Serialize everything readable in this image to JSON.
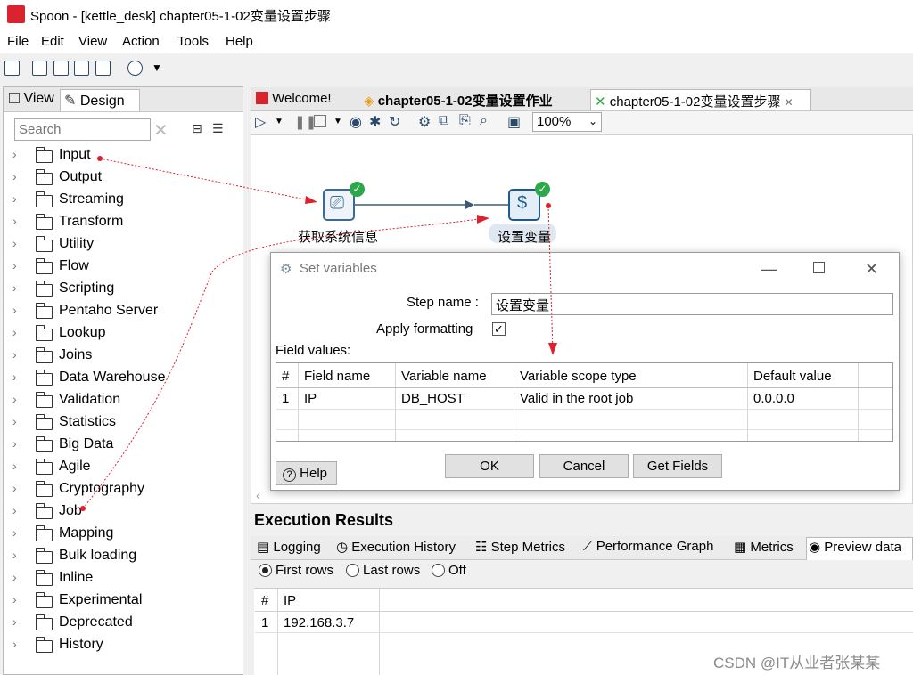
{
  "window": {
    "title": "Spoon - [kettle_desk] chapter05-1-02变量设置步骤"
  },
  "menu": [
    "File",
    "Edit",
    "View",
    "Action",
    "Tools",
    "Help"
  ],
  "left_panel": {
    "tabs": {
      "view": "View",
      "design": "Design"
    },
    "search": {
      "placeholder": "Search"
    },
    "tree": [
      "Input",
      "Output",
      "Streaming",
      "Transform",
      "Utility",
      "Flow",
      "Scripting",
      "Pentaho Server",
      "Lookup",
      "Joins",
      "Data Warehouse",
      "Validation",
      "Statistics",
      "Big Data",
      "Agile",
      "Cryptography",
      "Job",
      "Mapping",
      "Bulk loading",
      "Inline",
      "Experimental",
      "Deprecated",
      "History"
    ]
  },
  "editor_tabs": {
    "welcome": "Welcome!",
    "job": "chapter05-1-02变量设置作业",
    "transformation": "chapter05-1-02变量设置步骤"
  },
  "canvas_toolbar": {
    "zoom": "100%"
  },
  "canvas": {
    "steps": [
      {
        "label": "获取系统信息"
      },
      {
        "label": "设置变量"
      }
    ]
  },
  "dialog": {
    "title": "Set variables",
    "step_name_label": "Step name :",
    "step_name_value": "设置变量",
    "apply_formatting_label": "Apply formatting",
    "apply_formatting_checked": true,
    "field_values_label": "Field values:",
    "columns": [
      "#",
      "Field name",
      "Variable name",
      "Variable scope type",
      "Default value"
    ],
    "rows": [
      {
        "num": "1",
        "field": "IP",
        "variable": "DB_HOST",
        "scope": "Valid in the root job",
        "default": "0.0.0.0"
      }
    ],
    "buttons": {
      "help": "Help",
      "ok": "OK",
      "cancel": "Cancel",
      "get_fields": "Get Fields"
    }
  },
  "execution": {
    "title": "Execution Results",
    "tabs": [
      "Logging",
      "Execution History",
      "Step Metrics",
      "Performance Graph",
      "Metrics",
      "Preview data"
    ],
    "radios": {
      "first": "First rows",
      "last": "Last rows",
      "off": "Off"
    },
    "preview_columns": [
      "#",
      "IP"
    ],
    "preview_rows": [
      {
        "num": "1",
        "ip": "192.168.3.7"
      }
    ]
  },
  "watermark": "CSDN @IT从业者张某某",
  "colors": {
    "accent": "#3b6b92",
    "ok_badge": "#2aa84a",
    "annotation_arrow": "#e0202a"
  }
}
